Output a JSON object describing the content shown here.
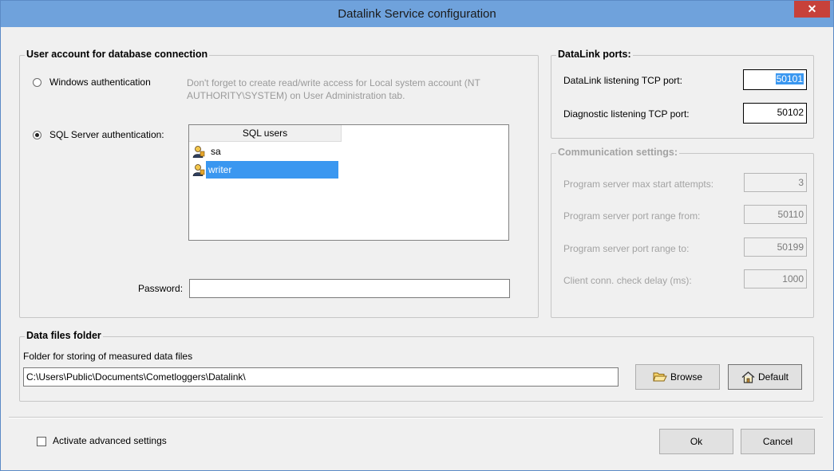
{
  "window": {
    "title": "Datalink Service configuration",
    "close_label": "✕"
  },
  "user_account": {
    "group_title": "User account for database connection",
    "windows_auth_label": "Windows authentication",
    "windows_auth_selected": false,
    "note": "Don't forget to create read/write access for Local system account (NT AUTHORITY\\SYSTEM) on User Administration tab.",
    "sql_auth_label": "SQL Server authentication:",
    "sql_auth_selected": true,
    "users_header": "SQL users",
    "users": [
      {
        "name": "sa",
        "selected": false
      },
      {
        "name": "writer",
        "selected": true
      }
    ],
    "password_label": "Password:",
    "password_value": ""
  },
  "datalink_ports": {
    "group_title": "DataLink ports:",
    "listening_label": "DataLink listening TCP port:",
    "listening_value": "50101",
    "diagnostic_label": "Diagnostic listening TCP port:",
    "diagnostic_value": "50102"
  },
  "communication": {
    "group_title": "Communication settings:",
    "max_start_label": "Program server max start attempts:",
    "max_start_value": "3",
    "range_from_label": "Program server port range from:",
    "range_from_value": "50110",
    "range_to_label": "Program server port range to:",
    "range_to_value": "50199",
    "check_delay_label": "Client conn. check delay (ms):",
    "check_delay_value": "1000"
  },
  "data_files": {
    "group_title": "Data files folder",
    "folder_label": "Folder for storing of measured data files",
    "folder_value": "C:\\Users\\Public\\Documents\\Cometloggers\\Datalink\\",
    "browse_label": "Browse",
    "default_label": "Default"
  },
  "footer": {
    "advanced_label": "Activate advanced settings",
    "advanced_checked": false,
    "ok_label": "Ok",
    "cancel_label": "Cancel"
  },
  "colors": {
    "titlebar": "#6fa2dc",
    "close_button": "#c7413a",
    "selection": "#3a97f0"
  }
}
